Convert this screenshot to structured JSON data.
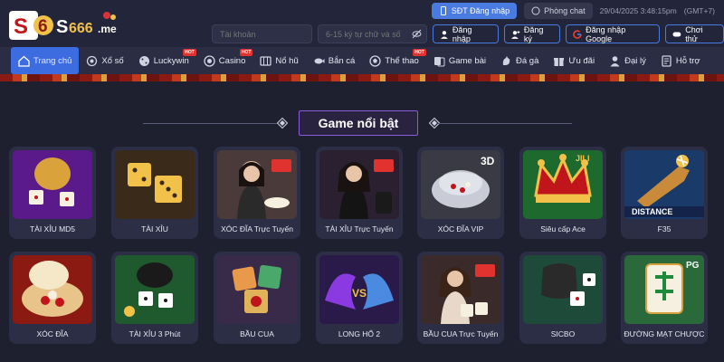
{
  "header": {
    "logo_text": "S6S666.me",
    "sdt_login": "SĐT Đăng nhập",
    "chat_room": "Phòng chat",
    "datetime": "29/04/2025 3:48:15pm",
    "timezone": "(GMT+7)",
    "username_placeholder": "Tài khoản",
    "password_placeholder": "6-15 ký tự chữ và số",
    "login": "Đăng nhập",
    "register": "Đăng ký",
    "google_login": "Đăng nhập Google",
    "try_play": "Chơi thử"
  },
  "nav": {
    "items": [
      {
        "label": "Trang chủ",
        "icon": "home-icon",
        "active": true
      },
      {
        "label": "Xổ số",
        "icon": "lottery-icon"
      },
      {
        "label": "Luckywin",
        "icon": "dice-icon",
        "hot": true
      },
      {
        "label": "Casino",
        "icon": "casino-icon",
        "hot": true
      },
      {
        "label": "Nổ hũ",
        "icon": "slot-icon"
      },
      {
        "label": "Bắn cá",
        "icon": "fish-icon"
      },
      {
        "label": "Thể thao",
        "icon": "sport-icon",
        "hot": true
      },
      {
        "label": "Game bài",
        "icon": "cards-icon"
      },
      {
        "label": "Đá gà",
        "icon": "rooster-icon"
      },
      {
        "label": "Ưu đãi",
        "icon": "gift-icon"
      },
      {
        "label": "Đại lý",
        "icon": "agent-icon"
      },
      {
        "label": "Hỗ trợ",
        "icon": "support-icon"
      }
    ],
    "hot_badge": "HOT"
  },
  "section": {
    "title": "Game nổi bật"
  },
  "games": [
    {
      "label": "TÀI XỈU MD5"
    },
    {
      "label": "TÀI XỈU"
    },
    {
      "label": "XÓC ĐĨA Trực Tuyến",
      "badge": "LIVE"
    },
    {
      "label": "TÀI XỈU Trực Tuyến",
      "badge": "LIVE"
    },
    {
      "label": "XÓC ĐĨA VIP",
      "badge": "3D"
    },
    {
      "label": "Siêu cấp Ace",
      "badge": "JILI"
    },
    {
      "label": "F35",
      "badge": "DISTANCE"
    },
    {
      "label": "XÓC ĐĨA"
    },
    {
      "label": "TÀI XỈU 3 Phút"
    },
    {
      "label": "BẦU CUA"
    },
    {
      "label": "LONG HỔ 2"
    },
    {
      "label": "BẦU CUA Trực Tuyến",
      "badge": "LIVE"
    },
    {
      "label": "SICBO"
    },
    {
      "label": "ĐƯỜNG MẠT CHƯỢC",
      "badge": "PG"
    }
  ],
  "colors": {
    "background": "#1e2030",
    "header": "#23253a",
    "nav": "#2b2d44",
    "accent": "#3d6be0",
    "card": "#2b2e45",
    "hot": "#e0322e"
  }
}
